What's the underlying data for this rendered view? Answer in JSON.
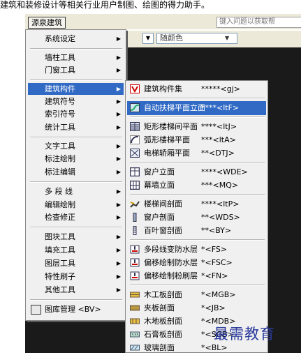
{
  "caption": "建筑和装修设计等相关行业用户制图、绘图的得力助手。",
  "menubar": {
    "title": "源泉建筑",
    "search_placeholder": "键入问题以获取帮"
  },
  "toolbar": {
    "color_value": "随颜色"
  },
  "left_menu": {
    "items": [
      {
        "label": "系统设定",
        "arrow": "▶"
      },
      {
        "label": "墙柱工具",
        "arrow": "▶"
      },
      {
        "label": "门窗工具",
        "arrow": "▶"
      },
      {
        "label": "建筑构件",
        "arrow": "▶"
      },
      {
        "label": "建筑符号",
        "arrow": "▶"
      },
      {
        "label": "索引符号",
        "arrow": "▶"
      },
      {
        "label": "统计工具",
        "arrow": "▶"
      },
      {
        "label": "文字工具",
        "arrow": "▶"
      },
      {
        "label": "标注绘制",
        "arrow": "▶"
      },
      {
        "label": "标注编辑",
        "arrow": "▶"
      },
      {
        "label": "多 段 线",
        "arrow": "▶"
      },
      {
        "label": "编辑绘制",
        "arrow": "▶"
      },
      {
        "label": "检查修正",
        "arrow": "▶"
      },
      {
        "label": "图块工具",
        "arrow": "▶"
      },
      {
        "label": "填充工具",
        "arrow": "▶"
      },
      {
        "label": "图层工具",
        "arrow": "▶"
      },
      {
        "label": "特性刷子",
        "arrow": "▶"
      },
      {
        "label": "其他工具",
        "arrow": "▶"
      },
      {
        "label": "图库管理 <BV>",
        "arrow": ""
      }
    ]
  },
  "right_menu": {
    "items": [
      {
        "label": "建筑构件集",
        "shortcut": "*****<gj>",
        "icon": "component-set-icon"
      },
      {
        "label": "自动扶梯平面立面",
        "shortcut": "****<ltF>",
        "icon": "escalator-icon"
      },
      {
        "label": "矩形楼梯间平面",
        "shortcut": "****<ltJ>",
        "icon": "rect-stair-icon"
      },
      {
        "label": "弧形楼梯平面",
        "shortcut": "***<ltA>",
        "icon": "arc-stair-icon"
      },
      {
        "label": "电梯轿厢平面",
        "shortcut": "**<DTJ>",
        "icon": "elevator-icon"
      },
      {
        "label": "窗户立面",
        "shortcut": "****<WDE>",
        "icon": "window-elevation-icon"
      },
      {
        "label": "幕墙立面",
        "shortcut": "***<MQ>",
        "icon": "curtain-wall-icon"
      },
      {
        "label": "楼梯间剖面",
        "shortcut": "****<ltP>",
        "icon": "stair-section-icon"
      },
      {
        "label": "窗户剖面",
        "shortcut": "**<WDS>",
        "icon": "window-section-icon"
      },
      {
        "label": "百叶窗剖面",
        "shortcut": "**<BY>",
        "icon": "louver-section-icon"
      },
      {
        "label": "多段线变防水层",
        "shortcut": "*<FS>",
        "icon": "waterproof-polyline-icon"
      },
      {
        "label": "偏移绘制防水层",
        "shortcut": "*<FSC>",
        "icon": "offset-waterproof-icon"
      },
      {
        "label": "偏移绘制粉刷层",
        "shortcut": "*<FN>",
        "icon": "offset-plaster-icon"
      },
      {
        "label": "木工板剖面",
        "shortcut": "*<MGB>",
        "icon": "woodboard-section-icon"
      },
      {
        "label": "夹板剖面",
        "shortcut": "*<JB>",
        "icon": "plywood-section-icon"
      },
      {
        "label": "木地板剖面",
        "shortcut": "*<MDB>",
        "icon": "wood-floor-section-icon"
      },
      {
        "label": "石膏板剖面",
        "shortcut": "*<SGB>",
        "icon": "gypsum-section-icon"
      },
      {
        "label": "玻璃剖面",
        "shortcut": "*<BL>",
        "icon": "glass-section-icon"
      }
    ]
  },
  "watermark": "最需教育",
  "colors": {
    "highlight": "#316ac5",
    "menu_bg": "#f0f0f0",
    "canvas_bg": "#1a1a1a"
  }
}
